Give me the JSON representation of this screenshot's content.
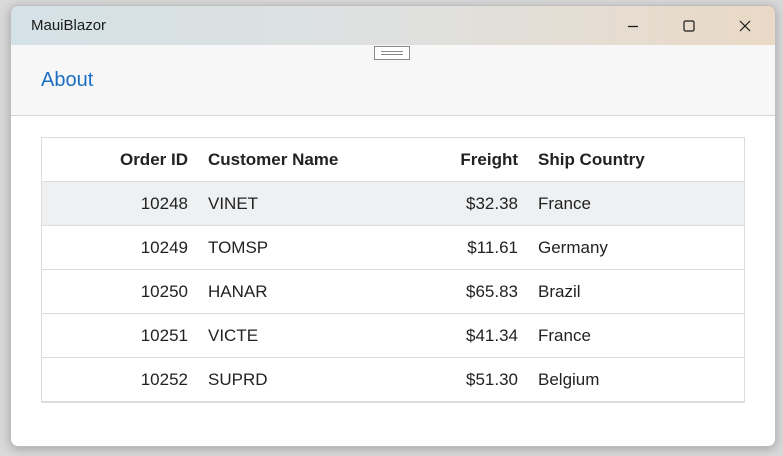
{
  "window": {
    "title": "MauiBlazor",
    "controls": {
      "minimize_icon": "minimize-icon",
      "maximize_icon": "maximize-icon",
      "close_icon": "close-icon"
    }
  },
  "appbar": {
    "about_label": "About"
  },
  "grid": {
    "columns": [
      "Order ID",
      "Customer Name",
      "Freight",
      "Ship Country"
    ],
    "rows": [
      {
        "order_id": "10248",
        "customer": "VINET",
        "freight": "$32.38",
        "country": "France"
      },
      {
        "order_id": "10249",
        "customer": "TOMSP",
        "freight": "$11.61",
        "country": "Germany"
      },
      {
        "order_id": "10250",
        "customer": "HANAR",
        "freight": "$65.83",
        "country": "Brazil"
      },
      {
        "order_id": "10251",
        "customer": "VICTE",
        "freight": "$41.34",
        "country": "France"
      },
      {
        "order_id": "10252",
        "customer": "SUPRD",
        "freight": "$51.30",
        "country": "Belgium"
      }
    ],
    "selected_row": 0
  },
  "colors": {
    "link": "#1b6ec2",
    "selected_row_bg": "#eef0f2",
    "titlebar_start": "#d4e1e6",
    "titlebar_end": "#ead9c6"
  }
}
